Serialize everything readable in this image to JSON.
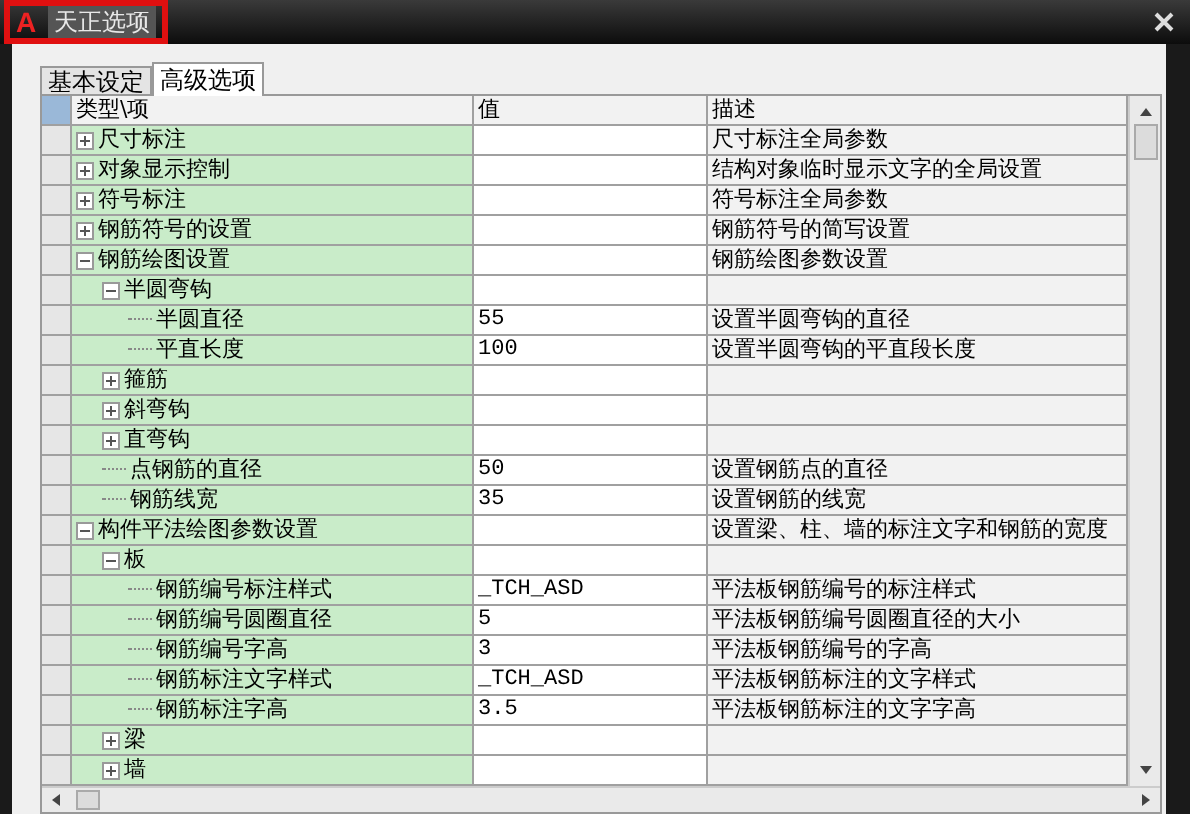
{
  "window": {
    "logo": "A",
    "title": "天正选项",
    "title_highlighted": true
  },
  "tabs": [
    {
      "label": "基本设定",
      "selected": false
    },
    {
      "label": "高级选项",
      "selected": true
    }
  ],
  "table": {
    "columns": [
      "类型\\项",
      "值",
      "描述"
    ],
    "rows": [
      {
        "name": "尺寸标注",
        "expanded": false,
        "description": "尺寸标注全局参数"
      },
      {
        "name": "对象显示控制",
        "expanded": false,
        "description": "结构对象临时显示文字的全局设置"
      },
      {
        "name": "符号标注",
        "expanded": false,
        "description": "符号标注全局参数"
      },
      {
        "name": "钢筋符号的设置",
        "expanded": false,
        "description": "钢筋符号的简写设置"
      },
      {
        "name": "钢筋绘图设置",
        "expanded": true,
        "description": "钢筋绘图参数设置",
        "children": [
          {
            "name": "半圆弯钩",
            "expanded": true,
            "children": [
              {
                "name": "半圆直径",
                "value": "55",
                "description": "设置半圆弯钩的直径"
              },
              {
                "name": "平直长度",
                "value": "100",
                "description": "设置半圆弯钩的平直段长度"
              }
            ]
          },
          {
            "name": "箍筋",
            "expanded": false
          },
          {
            "name": "斜弯钩",
            "expanded": false
          },
          {
            "name": "直弯钩",
            "expanded": false
          },
          {
            "name": "点钢筋的直径",
            "value": "50",
            "description": "设置钢筋点的直径"
          },
          {
            "name": "钢筋线宽",
            "value": "35",
            "description": "设置钢筋的线宽"
          }
        ]
      },
      {
        "name": "构件平法绘图参数设置",
        "expanded": true,
        "description": "设置梁、柱、墙的标注文字和钢筋的宽度",
        "children": [
          {
            "name": "板",
            "expanded": true,
            "children": [
              {
                "name": "钢筋编号标注样式",
                "value": "_TCH_ASD",
                "description": "平法板钢筋编号的标注样式"
              },
              {
                "name": "钢筋编号圆圈直径",
                "value": "5",
                "description": "平法板钢筋编号圆圈直径的大小"
              },
              {
                "name": "钢筋编号字高",
                "value": "3",
                "description": "平法板钢筋编号的字高"
              },
              {
                "name": "钢筋标注文字样式",
                "value": "_TCH_ASD",
                "description": "平法板钢筋标注的文字样式"
              },
              {
                "name": "钢筋标注字高",
                "value": "3.5",
                "description": "平法板钢筋标注的文字字高"
              }
            ]
          },
          {
            "name": "梁",
            "expanded": false
          },
          {
            "name": "墙",
            "expanded": false
          }
        ]
      }
    ]
  }
}
